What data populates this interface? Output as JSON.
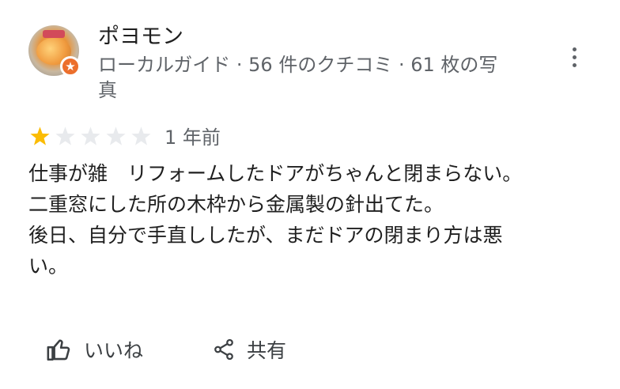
{
  "reviewer": {
    "name": "ポヨモン",
    "meta_line1": "ローカルガイド · 56 件のクチコミ · 61 枚の写",
    "meta_line2": "真",
    "badge_icon": "local-guide-star-icon",
    "badge_color": "#ec6f2c"
  },
  "menu": {
    "icon": "more-vert-icon"
  },
  "rating": {
    "value": 1,
    "max": 5,
    "filled_color": "#fbbc04",
    "empty_color": "#e8eaed"
  },
  "time": "1 年前",
  "review": {
    "lines": [
      "仕事が雑　リフォームしたドアがちゃんと閉まらない。",
      "二重窓にした所の木枠から金属製の針出てた。",
      "後日、自分で手直ししたが、まだドアの閉まり方は悪",
      "い。"
    ]
  },
  "actions": {
    "like_label": "いいね",
    "like_icon": "thumb-up-icon",
    "share_label": "共有",
    "share_icon": "share-icon"
  }
}
